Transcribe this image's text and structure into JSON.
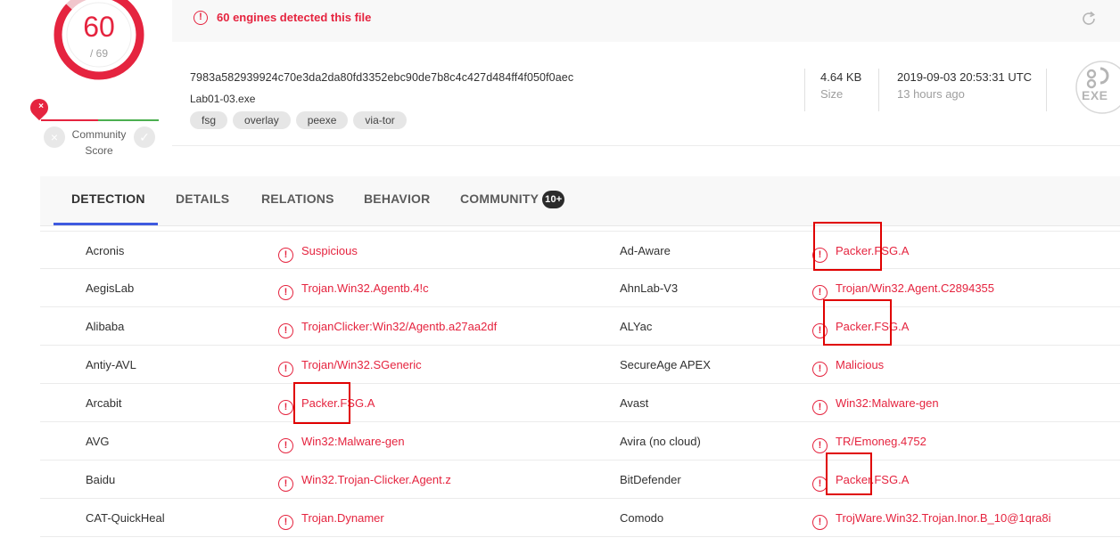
{
  "score": {
    "detected": "60",
    "total": "/ 69"
  },
  "community": {
    "label": "Community Score",
    "pin_icon": "×",
    "down_icon": "×",
    "up_icon": "✓"
  },
  "alert": {
    "icon": "!",
    "text": "60 engines detected this file"
  },
  "file": {
    "hash": "7983a582939924c70e3da2da80fd3352ebc90de7b8c4c427d484ff4f050f0aec",
    "name": "Lab01-03.exe",
    "tags": [
      "fsg",
      "overlay",
      "peexe",
      "via-tor"
    ],
    "size_value": "4.64 KB",
    "size_label": "Size",
    "date_value": "2019-09-03 20:53:31 UTC",
    "date_relative": "13 hours ago",
    "type_label": "EXE"
  },
  "tabs": [
    {
      "label": "DETECTION",
      "active": true
    },
    {
      "label": "DETAILS"
    },
    {
      "label": "RELATIONS"
    },
    {
      "label": "BEHAVIOR"
    },
    {
      "label": "COMMUNITY",
      "badge": "10+"
    }
  ],
  "colors": {
    "accent": "#e5243f",
    "tab_underline": "#3f5ae0",
    "highlight": "#e00000"
  },
  "detections": [
    {
      "engine_left": "Acronis",
      "result_left": "Suspicious",
      "engine_right": "Ad-Aware",
      "result_right": "Packer.FSG.A"
    },
    {
      "engine_left": "AegisLab",
      "result_left": "Trojan.Win32.Agentb.4!c",
      "engine_right": "AhnLab-V3",
      "result_right": "Trojan/Win32.Agent.C2894355"
    },
    {
      "engine_left": "Alibaba",
      "result_left": "TrojanClicker:Win32/Agentb.a27aa2df",
      "engine_right": "ALYac",
      "result_right": "Packer.FSG.A"
    },
    {
      "engine_left": "Antiy-AVL",
      "result_left": "Trojan/Win32.SGeneric",
      "engine_right": "SecureAge APEX",
      "result_right": "Malicious"
    },
    {
      "engine_left": "Arcabit",
      "result_left": "Packer.FSG.A",
      "engine_right": "Avast",
      "result_right": "Win32:Malware-gen"
    },
    {
      "engine_left": "AVG",
      "result_left": "Win32:Malware-gen",
      "engine_right": "Avira (no cloud)",
      "result_right": "TR/Emoneg.4752"
    },
    {
      "engine_left": "Baidu",
      "result_left": "Win32.Trojan-Clicker.Agent.z",
      "engine_right": "BitDefender",
      "result_right": "Packer.FSG.A"
    },
    {
      "engine_left": "CAT-QuickHeal",
      "result_left": "Trojan.Dynamer",
      "engine_right": "Comodo",
      "result_right": "TrojWare.Win32.Trojan.Inor.B_10@1qra8i"
    }
  ]
}
